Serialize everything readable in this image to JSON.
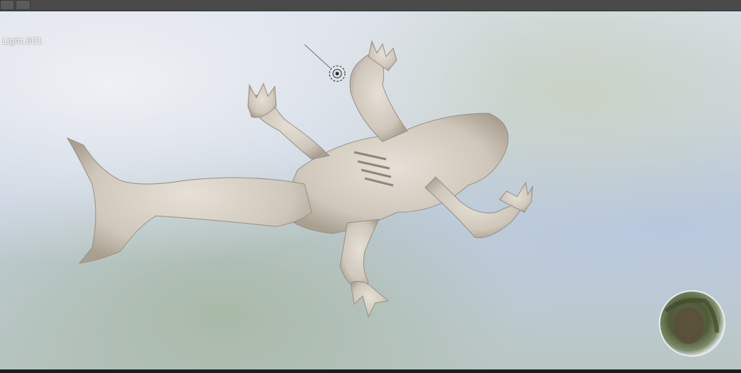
{
  "header": {
    "buttons": [
      {
        "icon": "view-toggle-icon"
      },
      {
        "icon": "overlay-toggle-icon"
      }
    ]
  },
  "viewport": {
    "selected_object_label": "Light.001",
    "model": "frog-sculpt",
    "light_icon": "light-icon",
    "hdri_preview_icon": "hdri-sphere-icon"
  },
  "colors": {
    "header_bg": "#4a4a4a",
    "model": "#d8d1c6",
    "model_shadow": "#a89e90"
  }
}
